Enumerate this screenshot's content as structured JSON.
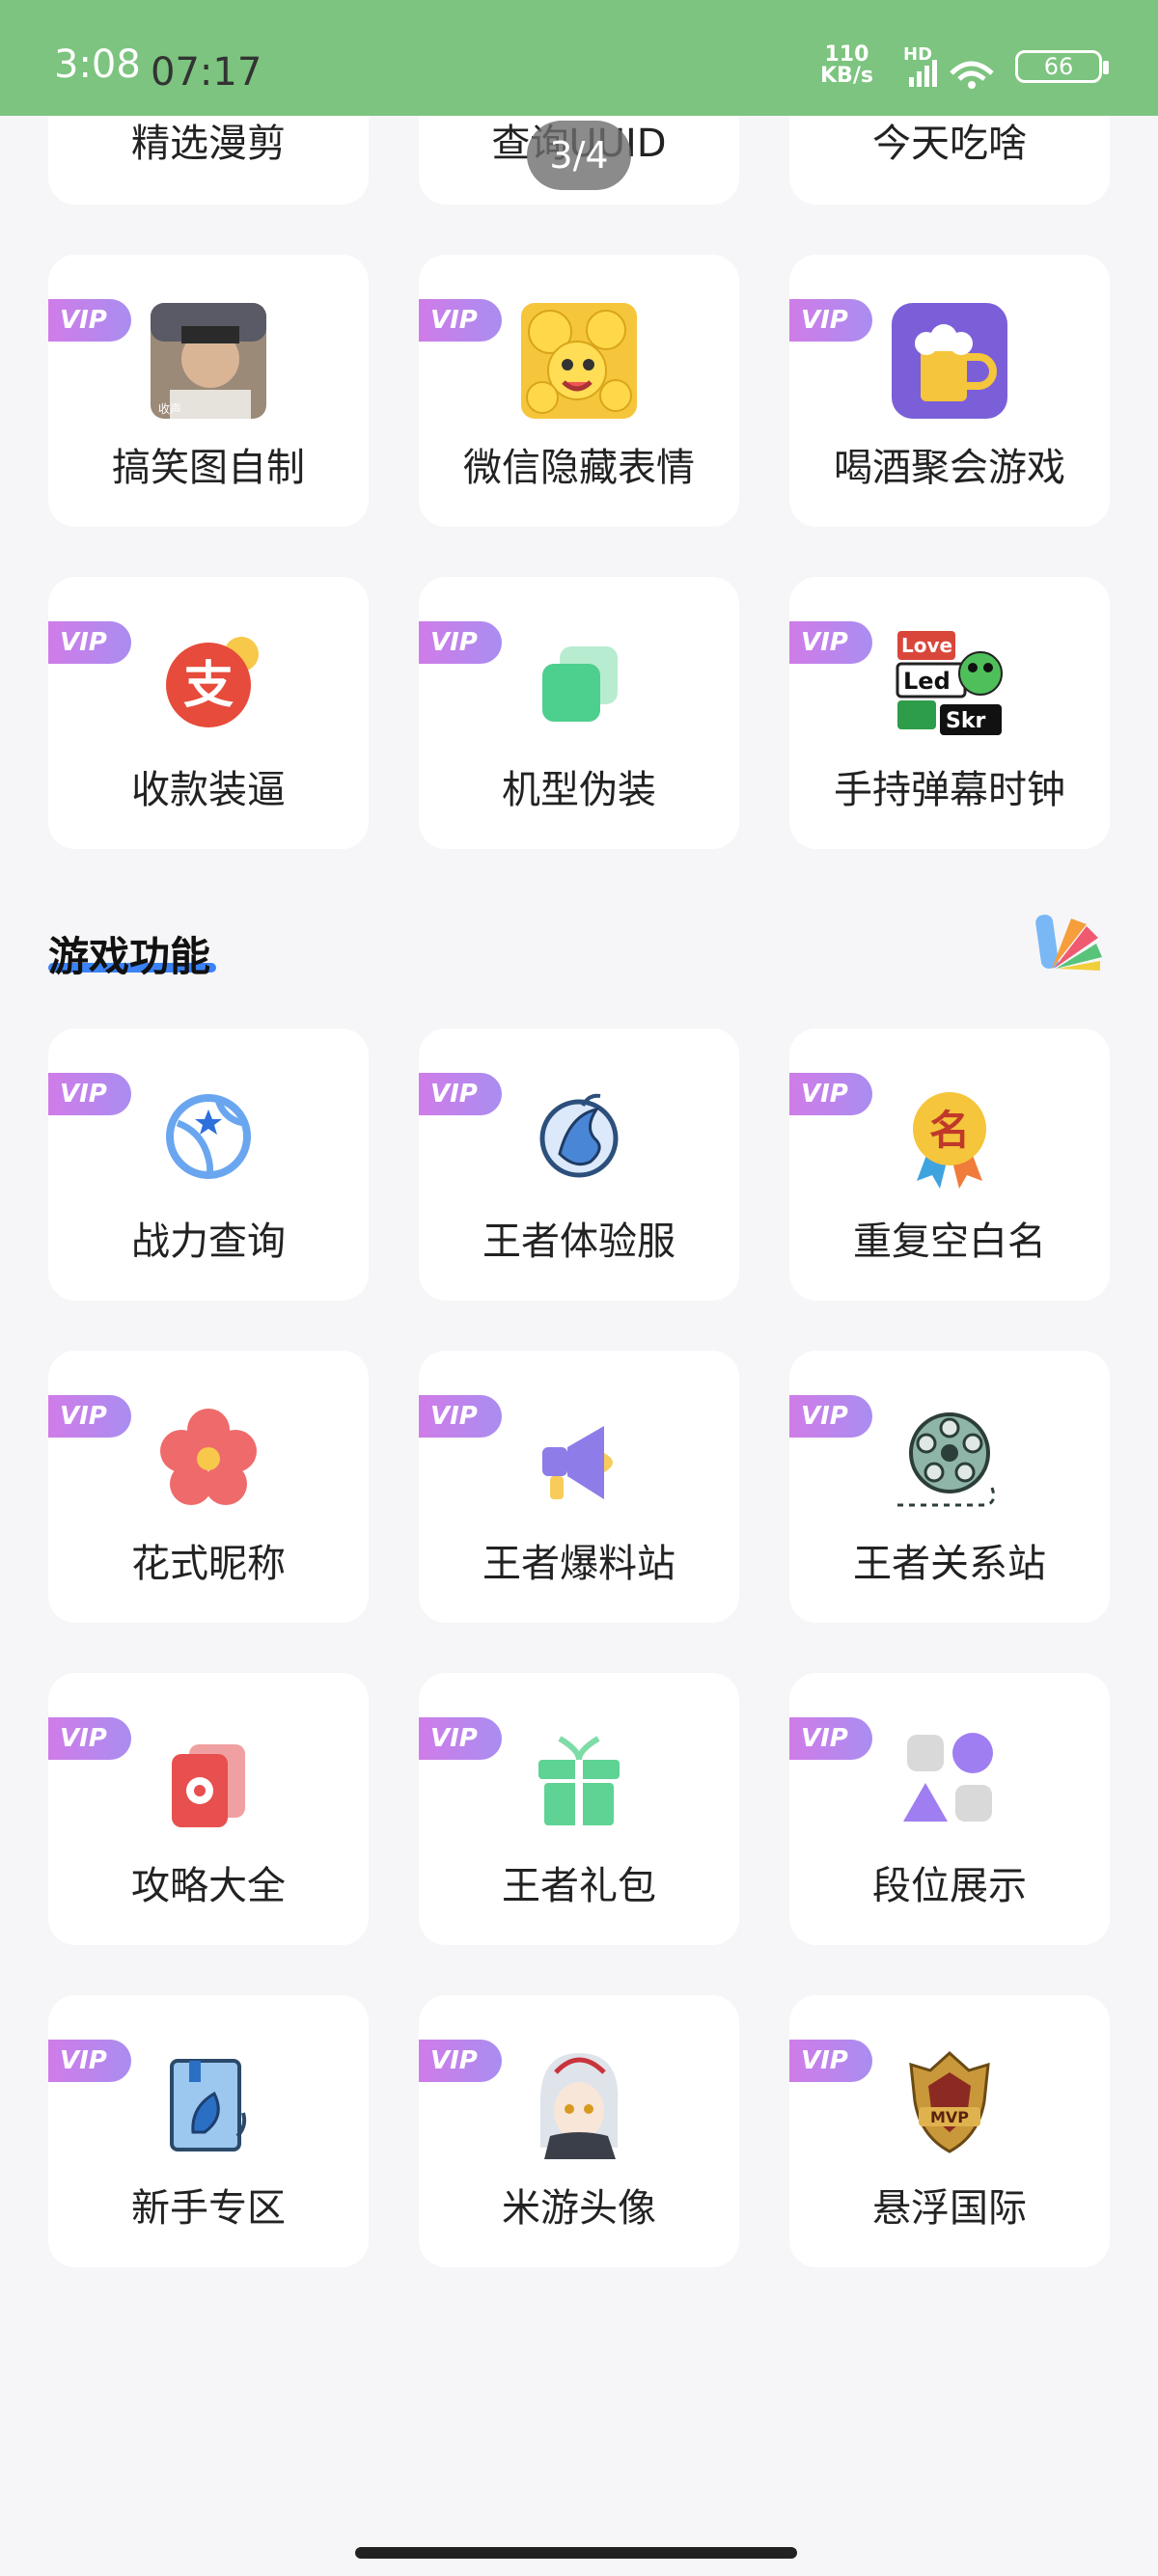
{
  "status_bar": {
    "time": "3:08",
    "time_overlay": "07:17",
    "net_speed_value": "110",
    "net_speed_unit": "KB/s",
    "hd_label": "HD",
    "battery": "66",
    "bg_color": "#7cc47f"
  },
  "pager": {
    "text": "3/4"
  },
  "top_row": [
    {
      "label": "精选漫剪"
    },
    {
      "label": "查询UUID"
    },
    {
      "label": "今天吃啥"
    }
  ],
  "vip_label": "VIP",
  "fun_tools": [
    {
      "label": "搞笑图自制",
      "icon": "meme-photo-icon"
    },
    {
      "label": "微信隐藏表情",
      "icon": "emoji-faces-icon"
    },
    {
      "label": "喝酒聚会游戏",
      "icon": "beer-mug-icon"
    },
    {
      "label": "收款装逼",
      "icon": "alipay-icon"
    },
    {
      "label": "机型伪装",
      "icon": "layers-icon"
    },
    {
      "label": "手持弹幕时钟",
      "icon": "led-sticker-icon"
    }
  ],
  "section": {
    "title": "游戏功能"
  },
  "game_tools": [
    {
      "label": "战力查询",
      "icon": "globe-star-icon"
    },
    {
      "label": "王者体验服",
      "icon": "phoenix-icon"
    },
    {
      "label": "重复空白名",
      "icon": "name-medal-icon"
    },
    {
      "label": "花式昵称",
      "icon": "flower-icon"
    },
    {
      "label": "王者爆料站",
      "icon": "megaphone-icon"
    },
    {
      "label": "王者关系站",
      "icon": "film-reel-icon"
    },
    {
      "label": "攻略大全",
      "icon": "cards-icon"
    },
    {
      "label": "王者礼包",
      "icon": "gift-icon"
    },
    {
      "label": "段位展示",
      "icon": "shapes-icon"
    },
    {
      "label": "新手专区",
      "icon": "leaf-book-icon"
    },
    {
      "label": "米游头像",
      "icon": "anime-avatar-icon"
    },
    {
      "label": "悬浮国际",
      "icon": "mvp-badge-icon"
    }
  ]
}
